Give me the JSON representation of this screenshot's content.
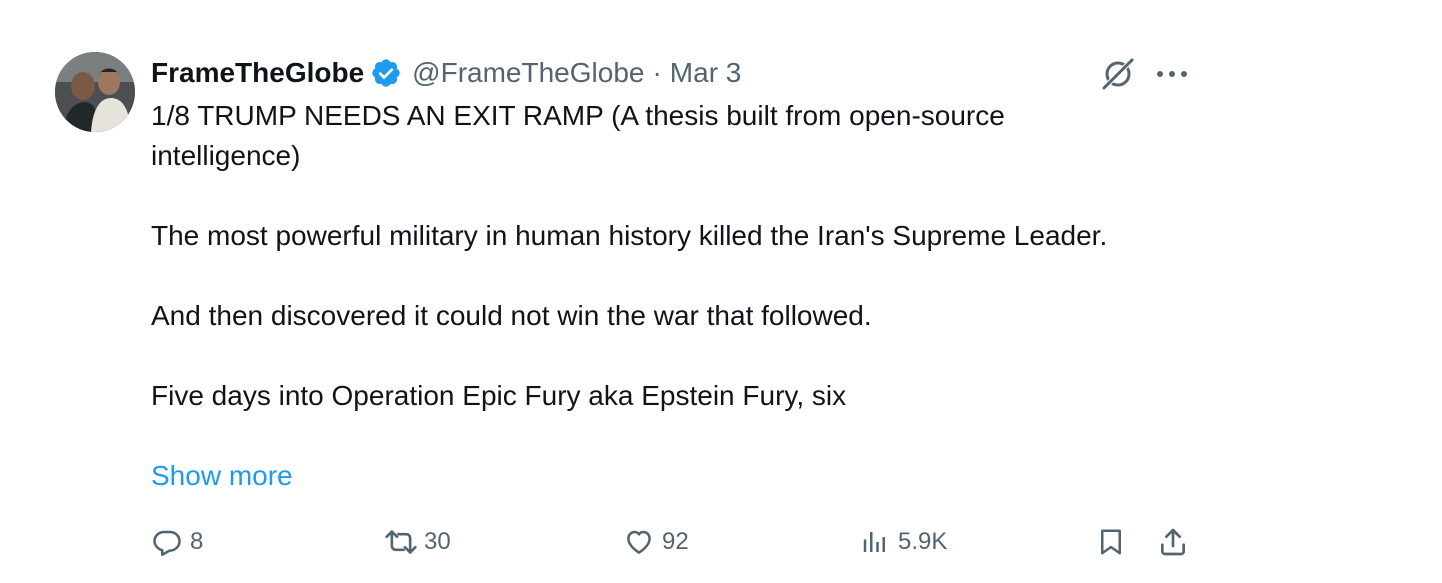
{
  "author": {
    "display_name": "FrameTheGlobe",
    "handle": "@FrameTheGlobe",
    "separator": "·",
    "date": "Mar 3",
    "verified": true,
    "verified_color": "#1d9bf0"
  },
  "tweet": {
    "paragraphs": [
      "1/8 TRUMP NEEDS AN EXIT RAMP (A thesis built from open-source intelligence)",
      "The most powerful military in human history killed the Iran's Supreme Leader.",
      "And then discovered it could not win the war that followed.",
      "Five days into Operation Epic Fury aka Epstein Fury, six"
    ],
    "show_more_label": "Show more"
  },
  "actions": {
    "replies": "8",
    "retweets": "30",
    "likes": "92",
    "views": "5.9K"
  },
  "icons": {
    "grok": "grok-icon",
    "more": "more-dots-icon",
    "reply": "reply-icon",
    "retweet": "retweet-icon",
    "like": "heart-icon",
    "views": "views-chart-icon",
    "bookmark": "bookmark-icon",
    "share": "share-icon"
  },
  "colors": {
    "text": "#0f1419",
    "secondary": "#536471",
    "link": "#1d9bf0"
  }
}
